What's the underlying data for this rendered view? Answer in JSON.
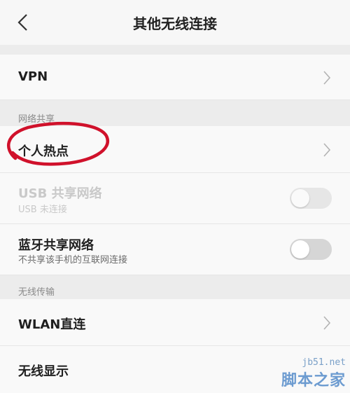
{
  "header": {
    "title": "其他无线连接",
    "back_icon": "chevron-left-icon"
  },
  "vpn": {
    "label": "VPN"
  },
  "sections": {
    "network_sharing": "网络共享",
    "wireless_transfer": "无线传输"
  },
  "items": {
    "hotspot": {
      "label": "个人热点"
    },
    "usb": {
      "label": "USB 共享网络",
      "sub": "USB 未连接",
      "enabled": false,
      "toggle_on": false
    },
    "bluetooth": {
      "label": "蓝牙共享网络",
      "sub": "不共享该手机的互联网连接",
      "toggle_on": false
    },
    "wlan_direct": {
      "label": "WLAN直连"
    },
    "wireless_display": {
      "label": "无线显示"
    }
  },
  "annotation": {
    "color": "#d0112b"
  },
  "watermark": {
    "url": "jb51.net",
    "name": "脚本之家"
  },
  "colors": {
    "accent_red": "#d0112b",
    "watermark_blue": "#6c9bd0"
  }
}
